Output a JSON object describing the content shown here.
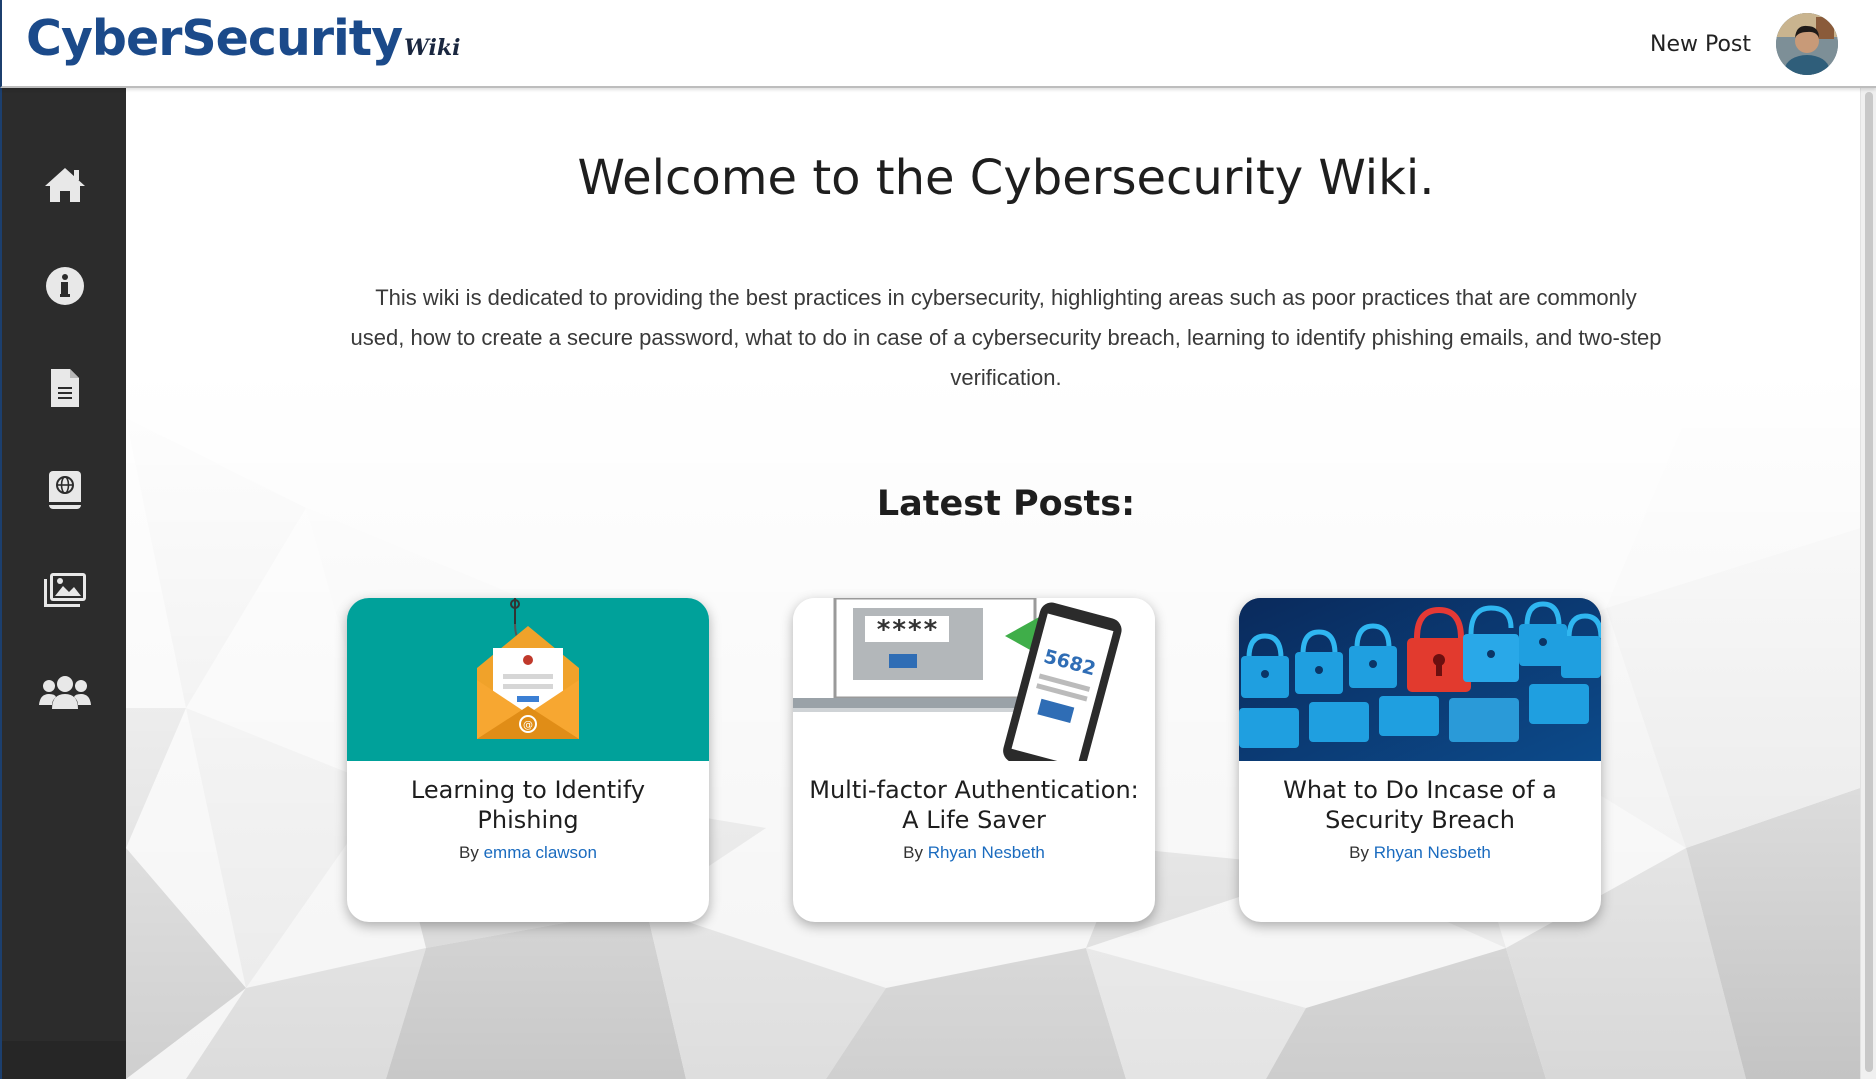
{
  "header": {
    "logo_main": "CyberSecurity",
    "logo_sub": "Wiki",
    "new_post_label": "New Post"
  },
  "sidebar": {
    "items": [
      {
        "icon": "home-icon"
      },
      {
        "icon": "info-icon"
      },
      {
        "icon": "document-icon"
      },
      {
        "icon": "globe-book-icon"
      },
      {
        "icon": "images-icon"
      },
      {
        "icon": "users-icon"
      }
    ]
  },
  "main": {
    "title": "Welcome to the Cybersecurity Wiki.",
    "intro": "This wiki is dedicated to providing the best practices in cybersecurity, highlighting areas such as poor practices that are commonly used, how to create a secure password, what to do in case of a cybersecurity breach, learning to identify phishing emails, and two-step verification.",
    "latest_heading": "Latest Posts:",
    "posts": [
      {
        "title": "Learning to Identify Phishing",
        "by": "By",
        "author": "emma clawson",
        "image_icon": "phishing-email-icon"
      },
      {
        "title": "Multi-factor Authentication: A Life Saver",
        "by": "By",
        "author": "Rhyan Nesbeth",
        "image_icon": "two-factor-phone-icon",
        "code": "5682",
        "mask": "****"
      },
      {
        "title": "What to Do Incase of a Security Breach",
        "by": "By",
        "author": "Rhyan Nesbeth",
        "image_icon": "padlocks-icon"
      }
    ]
  },
  "colors": {
    "brand": "#1b4a8a",
    "sidebar": "#2c2c2c",
    "link": "#1a6bbf",
    "phishing_bg": "#00a19a"
  }
}
